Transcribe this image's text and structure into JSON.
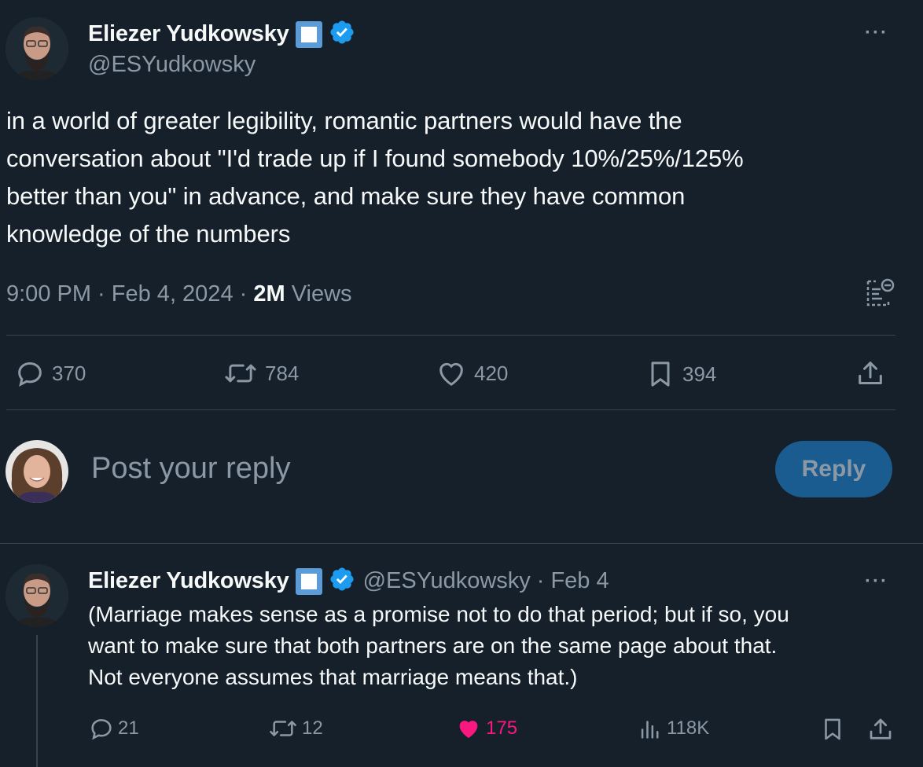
{
  "main_tweet": {
    "author_name": "Eliezer Yudkowsky",
    "author_handle": "@ESYudkowsky",
    "text_lines": [
      "in a world of greater legibility, romantic partners would have the",
      "conversation about \"I'd trade up if I found somebody 10%/25%/125%",
      "better than you\" in advance, and make sure they have common",
      "knowledge of the numbers"
    ],
    "time": "9:00 PM",
    "separator": " · ",
    "date": "Feb 4, 2024",
    "views_count": "2M",
    "views_label": " Views",
    "actions": {
      "replies": "370",
      "reposts": "784",
      "likes": "420",
      "bookmarks": "394"
    },
    "more_label": "···"
  },
  "reply_box": {
    "placeholder": "Post your reply",
    "button_label": "Reply"
  },
  "reply_tweet": {
    "author_name": "Eliezer Yudkowsky",
    "author_handle": "@ESYudkowsky",
    "date_sep": " · ",
    "date": "Feb 4",
    "text_lines": [
      "(Marriage makes sense as a promise not to do that period; but if so, you",
      "want to make sure that both partners are on the same page about that.",
      "Not everyone assumes that marriage means that.)"
    ],
    "actions": {
      "replies": "21",
      "reposts": "12",
      "likes": "175",
      "views": "118K"
    },
    "more_label": "···"
  },
  "colors": {
    "background": "#15202b",
    "verified": "#1d9bf0",
    "like_active": "#f91880",
    "muted": "#8b98a5"
  }
}
